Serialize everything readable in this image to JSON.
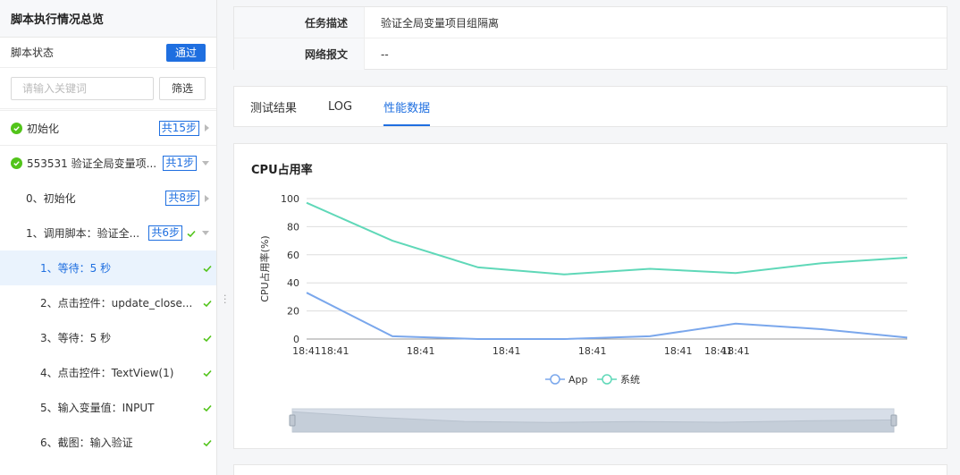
{
  "sidebar": {
    "title": "脚本执行情况总览",
    "status_label": "脚本状态",
    "status_badge": "通过",
    "search_placeholder": "请输入关键词",
    "filter_button": "筛选",
    "items": [
      {
        "text": "初始化",
        "badge": "共15步"
      },
      {
        "text": "553531 验证全局变量项...",
        "badge": "共1步"
      },
      {
        "text": "0、初始化",
        "badge": "共8步"
      },
      {
        "text": "1、调用脚本：验证全...",
        "badge": "共6步"
      },
      {
        "text": "1、等待：5 秒"
      },
      {
        "text": "2、点击控件：update_close..."
      },
      {
        "text": "3、等待：5 秒"
      },
      {
        "text": "4、点击控件：TextView(1)"
      },
      {
        "text": "5、输入变量值：INPUT"
      },
      {
        "text": "6、截图：输入验证"
      }
    ]
  },
  "info": {
    "rows": [
      {
        "label": "任务描述",
        "value": "验证全局变量项目组隔离"
      },
      {
        "label": "网络报文",
        "value": "--"
      }
    ]
  },
  "tabs": [
    {
      "label": "测试结果"
    },
    {
      "label": "LOG"
    },
    {
      "label": "性能数据"
    }
  ],
  "colors": {
    "accent": "#1f6fe0",
    "app": "#7aa7ec",
    "system": "#5fd8b8",
    "ok": "#52c41a"
  },
  "chart_data": {
    "type": "line",
    "title": "CPU占用率",
    "ylabel": "CPU占用率(%)",
    "xlabel": "",
    "ylim": [
      0,
      100
    ],
    "yticks": [
      0,
      20,
      40,
      60,
      80,
      100
    ],
    "x": [
      0,
      1,
      2,
      3,
      4,
      5,
      6,
      7
    ],
    "xtick_labels": [
      {
        "x": 0,
        "label": "18:41"
      },
      {
        "x": 0.33,
        "label": "18:41"
      },
      {
        "x": 1.33,
        "label": "18:41"
      },
      {
        "x": 2.33,
        "label": "18:41"
      },
      {
        "x": 3.33,
        "label": "18:41"
      },
      {
        "x": 4.33,
        "label": "18:41"
      },
      {
        "x": 4.8,
        "label": "18:41"
      },
      {
        "x": 5,
        "label": "18:41"
      }
    ],
    "series": [
      {
        "name": "App",
        "values": [
          33,
          2,
          0,
          0,
          2,
          11,
          7,
          1
        ]
      },
      {
        "name": "系统",
        "values": [
          97,
          70,
          51,
          46,
          50,
          47,
          54,
          58
        ]
      }
    ],
    "grid": true,
    "legend": "bottom-center"
  }
}
